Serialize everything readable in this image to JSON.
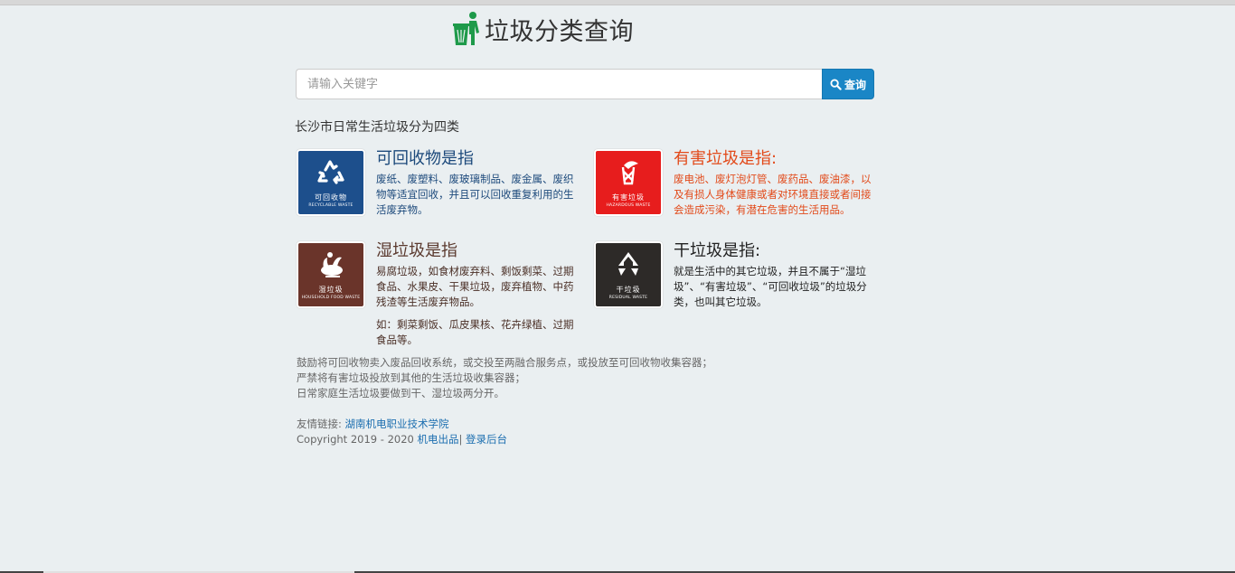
{
  "header": {
    "title": "垃圾分类查询",
    "logo_icon": "recycle-bin-person-icon"
  },
  "search": {
    "placeholder": "请输入关键字",
    "button_label": "查询",
    "button_icon": "search-icon",
    "accent": "#1a86c6"
  },
  "intro": "长沙市日常生活垃圾分为四类",
  "cards": {
    "recyclable": {
      "title": "可回收物是指",
      "label_cn": "可回收物",
      "label_en": "RECYCLABLE WASTE",
      "desc": "废纸、废塑料、废玻璃制品、废金属、废织物等适宜回收，并且可以回收重复利用的生活废弃物。",
      "color": "#1d4f8c",
      "icon": "recycle-icon"
    },
    "hazardous": {
      "title": "有害垃圾是指:",
      "label_cn": "有害垃圾",
      "label_en": "HAZARDOUS WASTE",
      "desc": "废电池、废灯泡灯管、废药品、废油漆，以及有损人身体健康或者对环境直接或者间接会造成污染，有潜在危害的生活用品。",
      "color": "#e71d1d",
      "icon": "hazard-icon"
    },
    "food": {
      "title": "湿垃圾是指",
      "label_cn": "湿垃圾",
      "label_en": "HOUSEHOLD FOOD WASTE",
      "desc": "易腐垃圾，如食材废弃料、剩饭剩菜、过期食品、水果皮、干果垃圾，废弃植物、中药残渣等生活废弃物品。",
      "extra": "如：剩菜剩饭、瓜皮果核、花卉绿植、过期食品等。",
      "color": "#6a342a",
      "icon": "food-waste-icon"
    },
    "residual": {
      "title": "干垃圾是指:",
      "label_cn": "干垃圾",
      "label_en": "RESIDUAL WASTE",
      "desc": "就是生活中的其它垃圾，并且不属于“湿垃圾”、“有害垃圾”、“可回收垃圾”的垃圾分类，也叫其它垃圾。",
      "color": "#2d2a28",
      "icon": "residual-waste-icon"
    }
  },
  "notes": [
    "鼓励将可回收物卖入废品回收系统，或交投至两融合服务点，或投放至可回收物收集容器；",
    "严禁将有害垃圾投放到其他的生活垃圾收集容器；",
    "日常家庭生活垃圾要做到干、湿垃圾两分开。"
  ],
  "footer": {
    "links_label": "友情链接:",
    "friend_link": "湖南机电职业技术学院",
    "copyright": "Copyright 2019 - 2020",
    "brand_link": "机电出品",
    "separator": "|",
    "admin_link": "登录后台"
  }
}
